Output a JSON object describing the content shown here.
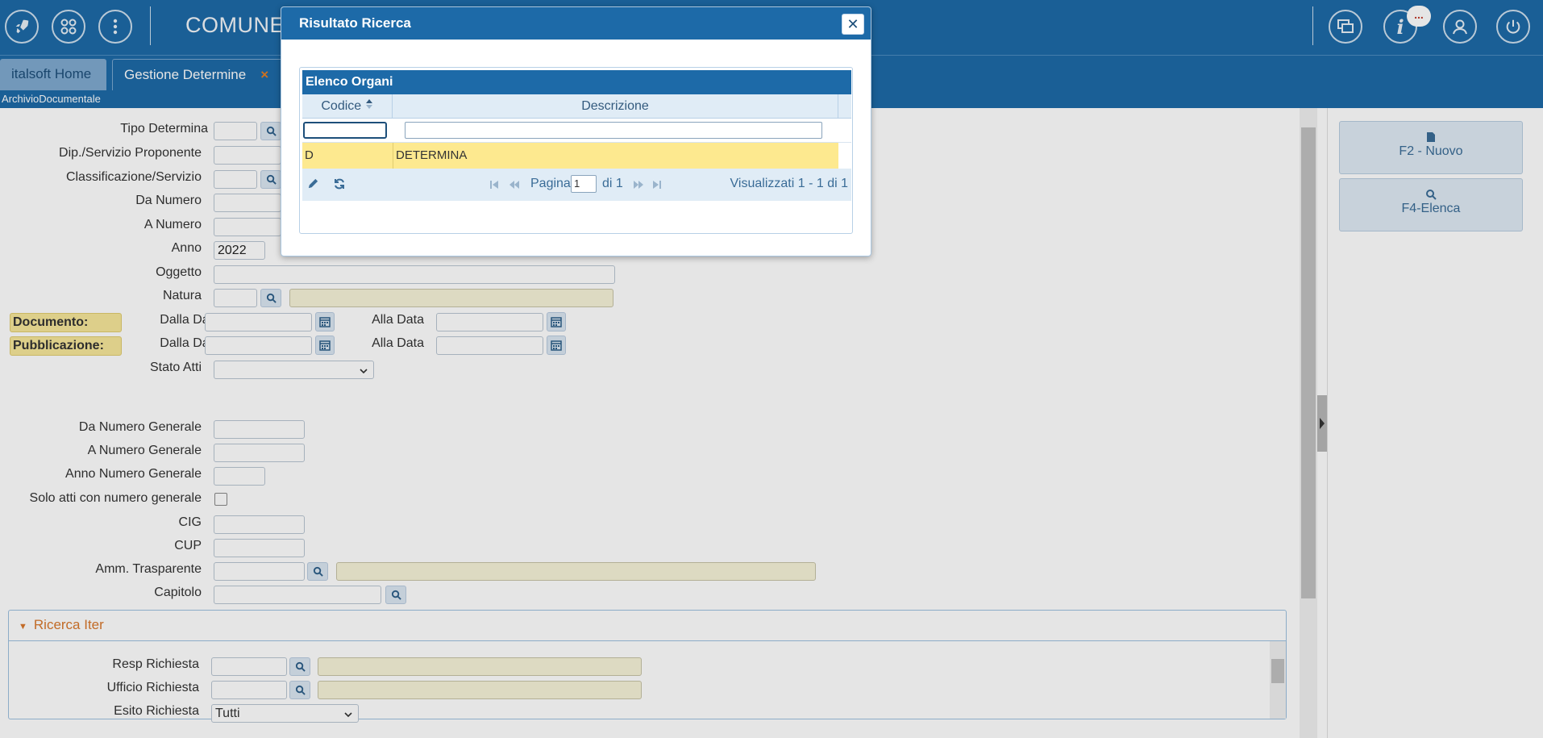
{
  "app": {
    "brand": "COMUNE",
    "notification_badge": "..."
  },
  "tabs": [
    {
      "label": "italsoft Home"
    },
    {
      "label": "Gestione Determine",
      "close": "×"
    }
  ],
  "breadcrumb": "ArchivioDocumentale",
  "form": {
    "tipo_determina": "Tipo Determina",
    "dip_servizio": "Dip./Servizio Proponente",
    "classificazione": "Classificazione/Servizio",
    "da_numero": "Da Numero",
    "a_numero": "A Numero",
    "anno": "Anno",
    "anno_value": "2022",
    "oggetto": "Oggetto",
    "natura": "Natura",
    "documento": "Documento:",
    "pubblicazione": "Pubblicazione:",
    "dalla_data": "Dalla Data",
    "alla_data": "Alla Data",
    "stato_atti": "Stato Atti",
    "da_numero_generale": "Da Numero Generale",
    "a_numero_generale": "A Numero Generale",
    "anno_numero_generale": "Anno Numero Generale",
    "solo_atti": "Solo atti con numero generale",
    "cig": "CIG",
    "cup": "CUP",
    "amm_trasparente": "Amm. Trasparente",
    "capitolo": "Capitolo"
  },
  "ricerca_iter": {
    "title": "Ricerca Iter",
    "resp_richiesta": "Resp Richiesta",
    "ufficio_richiesta": "Ufficio Richiesta",
    "esito_richiesta": "Esito Richiesta",
    "esito_value": "Tutti"
  },
  "right_panel": {
    "nuovo": "F2 - Nuovo",
    "elenca": "F4-Elenca"
  },
  "modal": {
    "title": "Risultato Ricerca",
    "grid_title": "Elenco Organi",
    "col_codice": "Codice",
    "col_descrizione": "Descrizione",
    "rows": [
      {
        "codice": "D",
        "descrizione": "DETERMINA"
      }
    ],
    "pager": {
      "pagina": "Pagina",
      "page_value": "1",
      "di": "di 1",
      "visualizzati": "Visualizzati 1 - 1 di 1"
    }
  },
  "colors": {
    "primary": "#1d6aa8",
    "highlight": "#fde98f",
    "accent": "#d9782c"
  }
}
